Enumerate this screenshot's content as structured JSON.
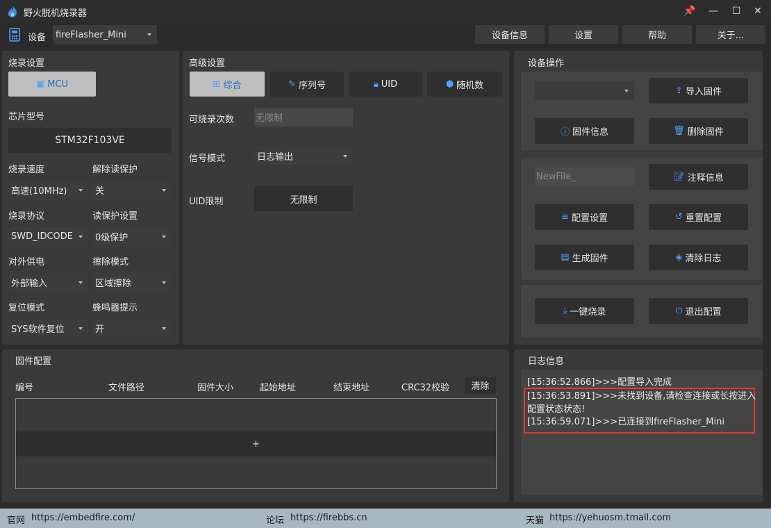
{
  "app": {
    "title": "野火脱机烧录器"
  },
  "window_controls": {
    "pin": "📌",
    "minimize": "—",
    "maximize": "☐",
    "close": "✕"
  },
  "device": {
    "label": "设备",
    "selected": "fireFlasher_Mini"
  },
  "top_buttons": {
    "device_info": "设备信息",
    "settings": "设置",
    "help": "帮助",
    "about": "关于..."
  },
  "burn_settings": {
    "title": "烧录设置",
    "mcu_button": "MCU",
    "chip_model_label": "芯片型号",
    "chip_model": "STM32F103VE",
    "speed_label": "烧录速度",
    "speed_value": "高速(10MHz)",
    "unlock_label": "解除读保护",
    "unlock_value": "关",
    "protocol_label": "烧录协议",
    "protocol_value": "SWD_IDCODE",
    "read_protect_label": "读保护设置",
    "read_protect_value": "0级保护",
    "power_label": "对外供电",
    "power_value": "外部输入",
    "erase_label": "擦除模式",
    "erase_value": "区域擦除",
    "reset_label": "复位模式",
    "reset_value": "SYS软件复位",
    "buzzer_label": "蜂鸣器提示",
    "buzzer_value": "开"
  },
  "advanced": {
    "title": "高级设置",
    "tabs": [
      "综合",
      "序列号",
      "UID",
      "随机数"
    ],
    "count_label": "可烧录次数",
    "count_placeholder": "无限制",
    "signal_label": "信号模式",
    "signal_value": "日志输出",
    "uid_limit_label": "UID限制",
    "uid_limit_value": "无限制"
  },
  "device_ops": {
    "title": "设备操作",
    "firmware_select": "",
    "import_firmware": "导入固件",
    "firmware_info": "固件信息",
    "delete_firmware": "删除固件",
    "filename_placeholder": "NewFile_",
    "comment_info": "注释信息",
    "config_settings": "配置设置",
    "reset_config": "重置配置",
    "generate_firmware": "生成固件",
    "clear_log": "清除日志",
    "one_click_burn": "一键烧录",
    "exit_config": "退出配置"
  },
  "firmware_config": {
    "title": "固件配置",
    "columns": [
      "编号",
      "文件路径",
      "固件大小",
      "起始地址",
      "结束地址",
      "CRC32校验"
    ],
    "clear_button": "清除",
    "add_row": "+"
  },
  "log": {
    "title": "日志信息",
    "lines": [
      "[15:36:52.866]>>>配置导入完成",
      "[15:36:53.891]>>>未找到设备,请检查连接或长按进入",
      "配置状态状态!",
      "[15:36:59.071]>>>已连接到fireFlasher_Mini"
    ],
    "highlight_color": "#e53935"
  },
  "statusbar": {
    "site_label": "官网",
    "site_url": "https://embedfire.com/",
    "forum_label": "论坛",
    "forum_url": "https://firebbs.cn",
    "tmall_label": "天猫",
    "tmall_url": "https://yehuosm.tmall.com"
  },
  "colors": {
    "accent": "#4aa3ff",
    "active_tab_bg": "#bfbfbf",
    "statusbar_bg": "#a7b8c2"
  }
}
